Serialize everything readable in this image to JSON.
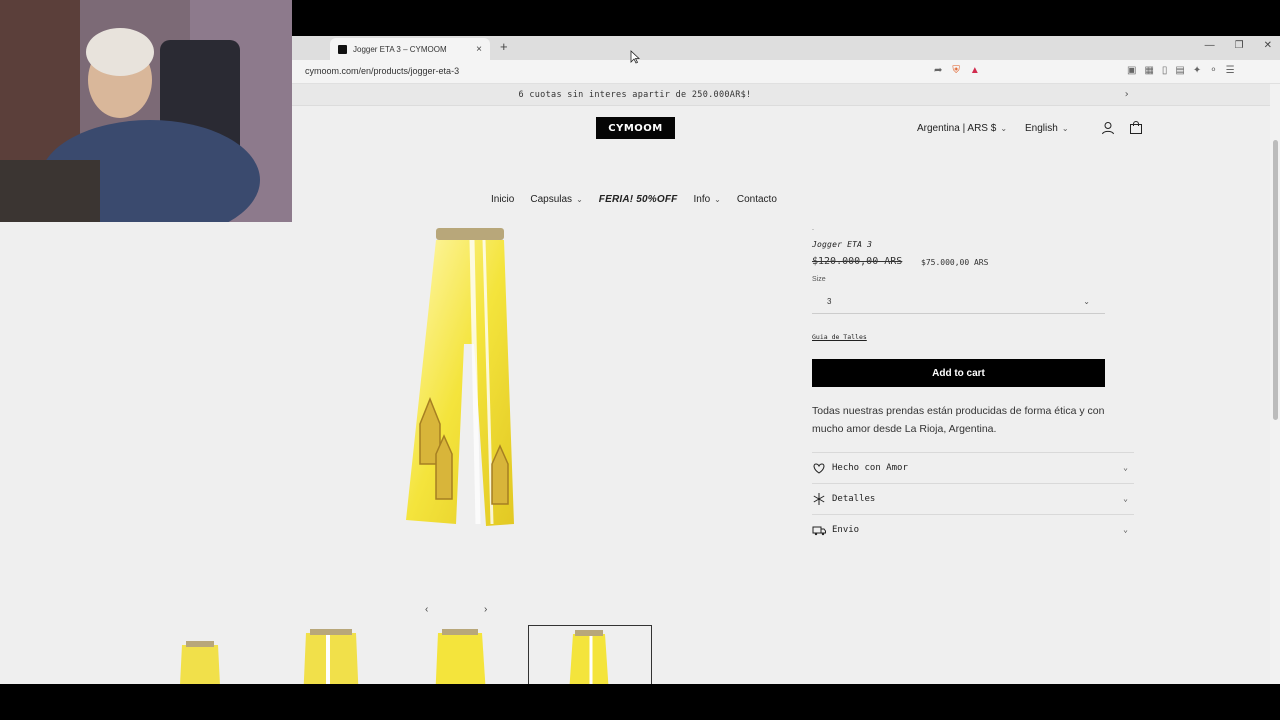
{
  "browser": {
    "tab_title": "Jogger ETA 3 – CYMOOM",
    "url": "cymoom.com/en/products/jogger-eta-3",
    "new_tab_symbol": "+",
    "close_symbol": "×"
  },
  "store": {
    "announcement": "6 cuotas sin interes apartir de 250.000AR$!",
    "logo_text": "CYMOOM",
    "country_currency": "Argentina | ARS $",
    "language": "English",
    "nav": [
      {
        "label": "Inicio"
      },
      {
        "label": "Capsulas"
      },
      {
        "label": "FERIA! 50%OFF"
      },
      {
        "label": "Info"
      },
      {
        "label": "Contacto"
      }
    ]
  },
  "product": {
    "vendor": "-",
    "title": "Jogger ETA 3",
    "price_regular": "$120.000,00 ARS",
    "price_sale": "$75.000,00 ARS",
    "size_label": "Size",
    "size_value": "3",
    "size_guide": "Guia de Talles",
    "add_to_cart": "Add to cart",
    "description": "Todas nuestras prendas están producidas de forma ética y con mucho amor desde La Rioja, Argentina.",
    "accordions": [
      {
        "label": "Hecho con Amor",
        "icon": "heart-icon"
      },
      {
        "label": "Detalles",
        "icon": "snowflake-icon"
      },
      {
        "label": "Envio",
        "icon": "truck-icon"
      }
    ]
  },
  "colors": {
    "accent_black": "#000000",
    "product_yellow": "#f2e23c",
    "page_bg": "#efefef"
  }
}
